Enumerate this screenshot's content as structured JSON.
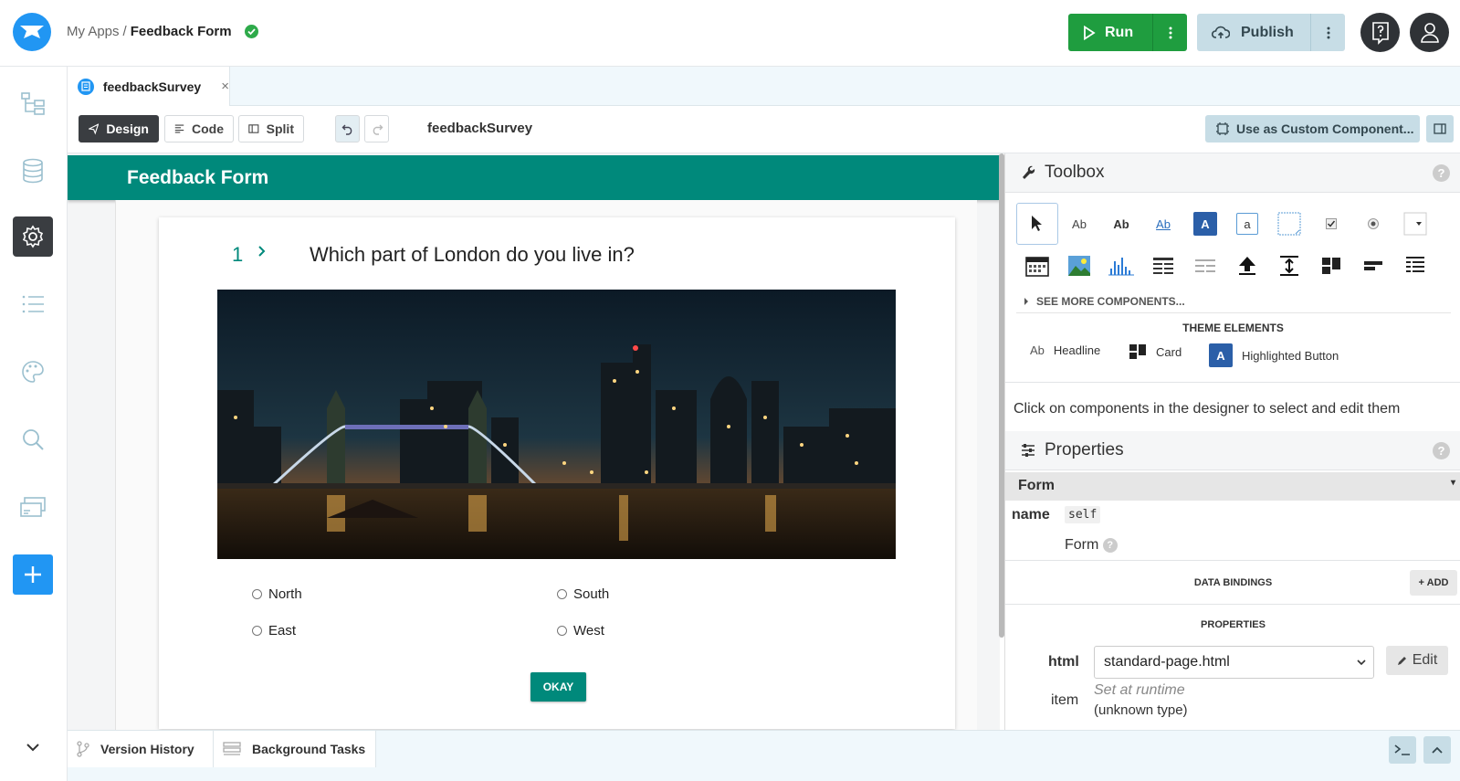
{
  "header": {
    "breadcrumb_root": "My Apps",
    "breadcrumb_sep": "/",
    "breadcrumb_current": "Feedback Form",
    "run_label": "Run",
    "publish_label": "Publish"
  },
  "colors": {
    "accent": "#00897b",
    "run": "#1f9d3f",
    "brand": "#2196f3",
    "publish": "#c7dde6"
  },
  "tabs": [
    {
      "label": "feedbackSurvey",
      "close": "×"
    }
  ],
  "editor": {
    "modes": [
      "Design",
      "Code",
      "Split"
    ],
    "active_mode": "Design",
    "title": "feedbackSurvey",
    "custom_component_label": "Use as Custom Component..."
  },
  "form": {
    "header_title": "Feedback Form",
    "question_number": "1",
    "question_text": "Which part of London do you live in?",
    "image_alt": "London skyline at night with Tower Bridge",
    "options": [
      "North",
      "South",
      "East",
      "West"
    ],
    "submit_label": "OKAY"
  },
  "toolbox": {
    "title": "Toolbox",
    "help": "?",
    "row1_icons": [
      "pointer-icon",
      "label-icon",
      "bold-label-icon",
      "link-icon",
      "button-icon",
      "textbox-icon",
      "textarea-icon",
      "checkbox-icon",
      "radio-icon",
      "dropdown-icon"
    ],
    "row1_text": {
      "label": "Ab",
      "bold": "Ab",
      "link": "Ab",
      "button": "A",
      "textbox": "a"
    },
    "row2_icons": [
      "calendar-icon",
      "image-icon",
      "plot-icon",
      "data-grid-icon",
      "repeating-panel-icon",
      "file-loader-icon",
      "spacer-icon",
      "column-panel-icon",
      "linear-panel-icon",
      "flow-panel-icon"
    ],
    "see_more": "SEE MORE COMPONENTS...",
    "theme_heading": "THEME ELEMENTS",
    "theme_items": [
      {
        "icon": "Ab",
        "label": "Headline"
      },
      {
        "icon": "card-icon",
        "label": "Card"
      },
      {
        "icon": "A",
        "label": "Highlighted Button"
      }
    ]
  },
  "properties": {
    "hint": "Click on components in the designer to select and edit them",
    "title": "Properties",
    "help": "?",
    "component": "Form",
    "name_label": "name",
    "name_value": "self",
    "type_label": "Form",
    "data_bindings_heading": "DATA BINDINGS",
    "add_label": "+ ADD",
    "properties_heading": "PROPERTIES",
    "html_label": "html",
    "html_value": "standard-page.html",
    "edit_label": "Edit",
    "item_label": "item",
    "item_value": "Set at runtime",
    "item_type": "(unknown type)"
  },
  "bottom": {
    "version_history": "Version History",
    "background_tasks": "Background Tasks"
  }
}
